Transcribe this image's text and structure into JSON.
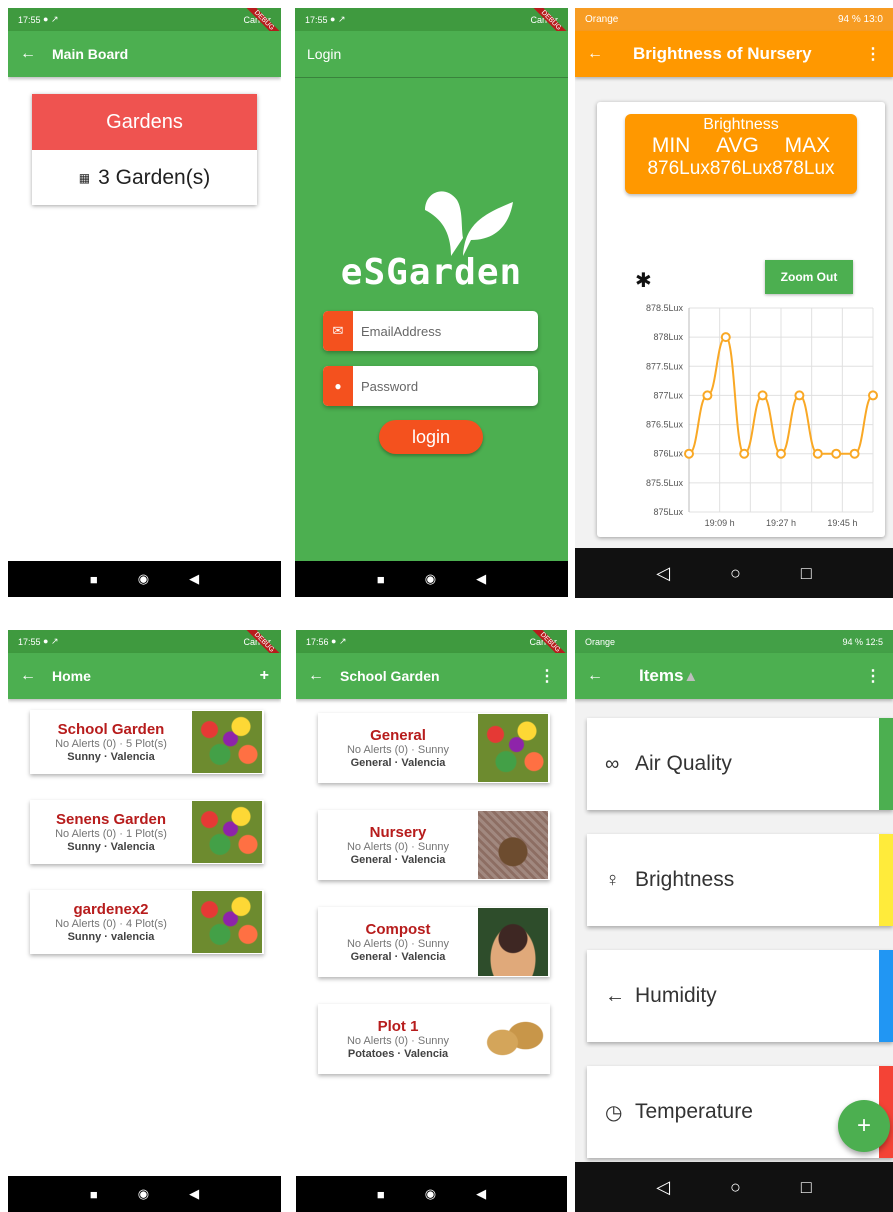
{
  "screens": {
    "main_board": {
      "time": "17:55",
      "carrier": "Carrier",
      "title": "Main Board",
      "card_title": "Gardens",
      "card_count": "3 Garden(s)",
      "debug": "DEBUG"
    },
    "login": {
      "time": "17:55",
      "carrier": "Carrier",
      "title": "Login",
      "logo": "eSGarden",
      "email_placeholder": "EmailAddress",
      "password_placeholder": "Password",
      "login_button": "login"
    },
    "brightness": {
      "carrier": "Orange",
      "battery": "94 %",
      "clock": "13:0",
      "title": "Brightness of Nursery",
      "box_title": "Brightness",
      "box_headers": [
        "MIN",
        "AVG",
        "MAX"
      ],
      "box_values": [
        "876Lux",
        "876Lux",
        "878Lux"
      ],
      "zoom_out": "Zoom Out"
    },
    "home": {
      "time": "17:55",
      "carrier": "Carrier",
      "title": "Home",
      "add": "+",
      "gardens": [
        {
          "name": "School Garden",
          "line1": "No Alerts (0) · 5 Plot(s)",
          "line2": "Sunny · Valencia"
        },
        {
          "name": "Senens Garden",
          "line1": "No Alerts (0) · 1 Plot(s)",
          "line2": "Sunny · Valencia"
        },
        {
          "name": "gardenex2",
          "line1": "No Alerts (0) · 4 Plot(s)",
          "line2": "Sunny · valencia"
        }
      ]
    },
    "school_garden": {
      "time": "17:56",
      "carrier": "Carrier",
      "title": "School Garden",
      "plots": [
        {
          "name": "General",
          "line1": "No Alerts (0) · Sunny",
          "line2": "General · Valencia"
        },
        {
          "name": "Nursery",
          "line1": "No Alerts (0) · Sunny",
          "line2": "General · Valencia"
        },
        {
          "name": "Compost",
          "line1": "No Alerts (0) · Sunny",
          "line2": "General · Valencia"
        },
        {
          "name": "Plot 1",
          "line1": "No Alerts (0) · Sunny",
          "line2": "Potatoes · Valencia"
        }
      ]
    },
    "items": {
      "carrier": "Orange",
      "battery": "94 %",
      "clock": "12:5",
      "title": "Items",
      "list": [
        {
          "label": "Air Quality",
          "icon": "infinity-icon",
          "color": "#4caf50"
        },
        {
          "label": "Brightness",
          "icon": "lightbulb-icon",
          "color": "#ffeb3b"
        },
        {
          "label": "Humidity",
          "icon": "arrow-left-icon",
          "color": "#2196f3"
        },
        {
          "label": "Temperature",
          "icon": "clock-icon",
          "color": "#f44336"
        }
      ],
      "fab": "+"
    }
  },
  "chart_data": {
    "type": "line",
    "title": "",
    "xlabel": "",
    "ylabel": "",
    "yticks": [
      "875Lux",
      "875.5Lux",
      "876Lux",
      "876.5Lux",
      "877Lux",
      "877.5Lux",
      "878Lux",
      "878.5Lux"
    ],
    "xticks": [
      "19:09 h",
      "19:27 h",
      "19:45 h"
    ],
    "ylim": [
      875,
      878.5
    ],
    "series": [
      {
        "values": [
          876,
          877,
          878,
          876,
          877,
          876,
          877,
          876,
          876,
          876,
          877
        ]
      }
    ],
    "grid": true,
    "color": "#f9a825"
  }
}
